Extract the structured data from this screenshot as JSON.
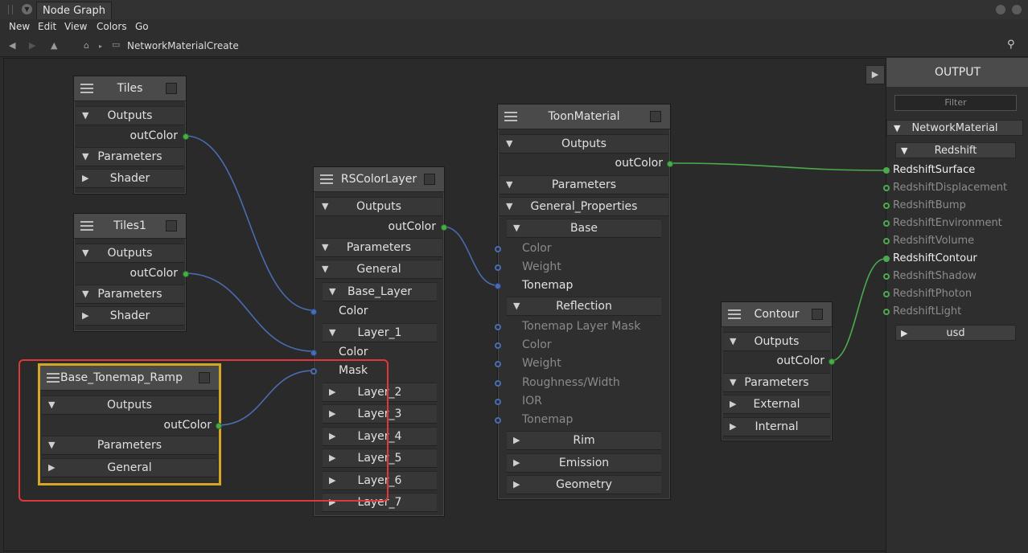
{
  "window": {
    "tab": "Node Graph"
  },
  "menu": [
    "New",
    "Edit",
    "View",
    "Colors",
    "Go"
  ],
  "breadcrumb": "NetworkMaterialCreate",
  "labels": {
    "outputs": "Outputs",
    "parameters": "Parameters",
    "outColor": "outColor",
    "shader": "Shader",
    "general": "General",
    "color": "Color",
    "mask": "Mask",
    "external": "External",
    "internal": "Internal"
  },
  "nodes": {
    "tiles": {
      "title": "Tiles"
    },
    "tiles1": {
      "title": "Tiles1"
    },
    "ramp": {
      "title": "Base_Tonemap_Ramp"
    },
    "rscolorlayer": {
      "title": "RSColorLayer",
      "base_layer": "Base_Layer",
      "layer_1": "Layer_1",
      "layers": [
        "Layer_2",
        "Layer_3",
        "Layer_4",
        "Layer_5",
        "Layer_6",
        "Layer_7"
      ]
    },
    "toon": {
      "title": "ToonMaterial",
      "general_properties": "General_Properties",
      "base": "Base",
      "base_ports": [
        "Color",
        "Weight",
        "Tonemap"
      ],
      "reflection": "Reflection",
      "reflection_ports": [
        "Tonemap Layer Mask",
        "Color",
        "Weight",
        "Roughness/Width",
        "IOR",
        "Tonemap"
      ],
      "rim": "Rim",
      "emission": "Emission",
      "geometry": "Geometry"
    },
    "contour": {
      "title": "Contour"
    }
  },
  "output_panel": {
    "title": "OUTPUT",
    "filter_placeholder": "Filter",
    "network_material": "NetworkMaterial",
    "redshift": "Redshift",
    "items": [
      "RedshiftSurface",
      "RedshiftDisplacement",
      "RedshiftBump",
      "RedshiftEnvironment",
      "RedshiftVolume",
      "RedshiftContour",
      "RedshiftShadow",
      "RedshiftPhoton",
      "RedshiftLight"
    ],
    "usd": "usd"
  },
  "colors": {
    "wire_blue": "#4a6cb0",
    "wire_green": "#4caa4c",
    "selection": "#d6a626",
    "highlight": "#e0383a"
  }
}
